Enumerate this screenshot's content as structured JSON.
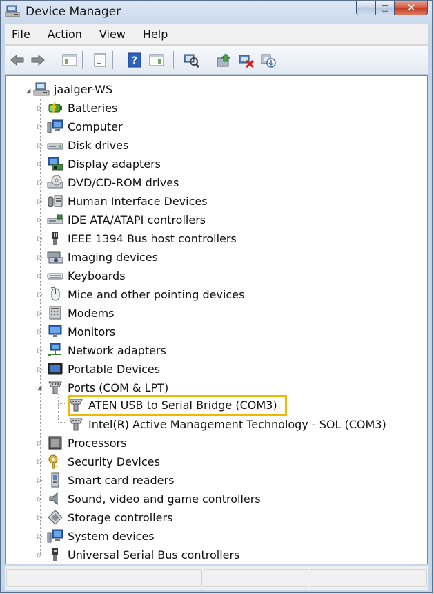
{
  "window": {
    "title": "Device Manager",
    "caption_buttons": {
      "minimize": "—",
      "maximize": "□",
      "close": "✕"
    }
  },
  "menubar": {
    "items": [
      {
        "label": "File",
        "accel": "F",
        "rest": "ile"
      },
      {
        "label": "Action",
        "accel": "A",
        "rest": "ction"
      },
      {
        "label": "View",
        "accel": "V",
        "rest": "iew"
      },
      {
        "label": "Help",
        "accel": "H",
        "rest": "elp"
      }
    ]
  },
  "toolbar": {
    "icons": [
      "back-icon",
      "forward-icon",
      "show-hide-console-tree-icon",
      "properties-icon",
      "help-icon",
      "show-hide-action-pane-icon",
      "scan-hardware-icon",
      "update-driver-icon",
      "uninstall-icon",
      "disable-device-icon"
    ]
  },
  "tree": {
    "root": {
      "label": "jaalger-WS",
      "icon": "computer-root-icon",
      "expanded": true
    },
    "categories": [
      {
        "label": "Batteries",
        "icon": "battery-icon"
      },
      {
        "label": "Computer",
        "icon": "computer-icon"
      },
      {
        "label": "Disk drives",
        "icon": "disk-drive-icon"
      },
      {
        "label": "Display adapters",
        "icon": "display-adapter-icon"
      },
      {
        "label": "DVD/CD-ROM drives",
        "icon": "dvd-drive-icon"
      },
      {
        "label": "Human Interface Devices",
        "icon": "hid-icon"
      },
      {
        "label": "IDE ATA/ATAPI controllers",
        "icon": "ide-controller-icon"
      },
      {
        "label": "IEEE 1394 Bus host controllers",
        "icon": "ieee1394-icon"
      },
      {
        "label": "Imaging devices",
        "icon": "camera-icon"
      },
      {
        "label": "Keyboards",
        "icon": "keyboard-icon"
      },
      {
        "label": "Mice and other pointing devices",
        "icon": "mouse-icon"
      },
      {
        "label": "Modems",
        "icon": "modem-icon"
      },
      {
        "label": "Monitors",
        "icon": "monitor-icon"
      },
      {
        "label": "Network adapters",
        "icon": "network-adapter-icon"
      },
      {
        "label": "Portable Devices",
        "icon": "portable-device-icon"
      },
      {
        "label": "Ports (COM & LPT)",
        "icon": "port-icon",
        "expanded": true,
        "children": [
          {
            "label": "ATEN USB to Serial Bridge (COM3)",
            "icon": "port-icon",
            "highlighted": true
          },
          {
            "label": "Intel(R) Active Management Technology - SOL (COM3)",
            "icon": "port-icon"
          }
        ]
      },
      {
        "label": "Processors",
        "icon": "processor-icon"
      },
      {
        "label": "Security Devices",
        "icon": "security-key-icon"
      },
      {
        "label": "Smart card readers",
        "icon": "smart-card-icon"
      },
      {
        "label": "Sound, video and game controllers",
        "icon": "speaker-icon"
      },
      {
        "label": "Storage controllers",
        "icon": "storage-controller-icon"
      },
      {
        "label": "System devices",
        "icon": "system-devices-icon"
      },
      {
        "label": "Universal Serial Bus controllers",
        "icon": "usb-icon"
      }
    ]
  },
  "colors": {
    "highlight_border": "#f2b700",
    "window_frame": "#c6d6ea"
  }
}
